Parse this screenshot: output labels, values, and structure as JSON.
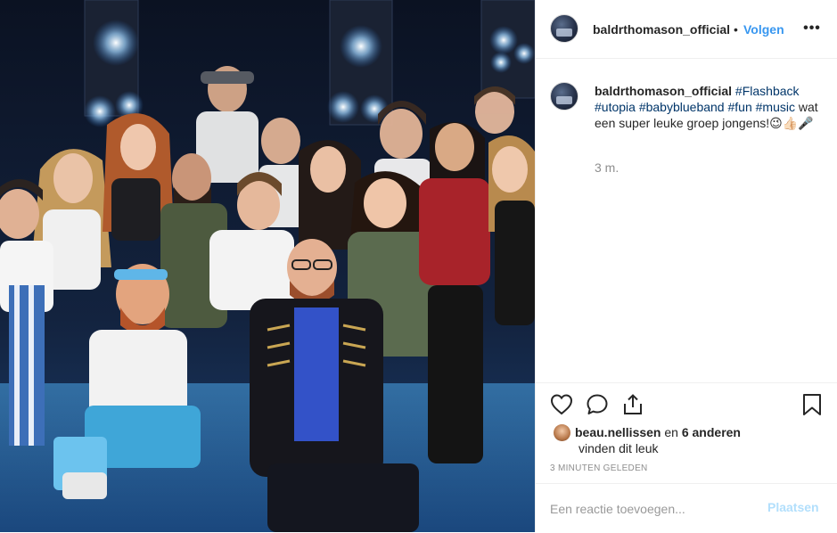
{
  "post": {
    "username": "baldrthomason_official",
    "follow_label": "Volgen",
    "dot": "•",
    "more_icon": "more-options-icon",
    "more_glyph": "•••"
  },
  "caption": {
    "username": "baldrthomason_official",
    "hashtags": [
      "#Flashback",
      "#utopia",
      "#babyblueband",
      "#fun",
      "#music"
    ],
    "text": "wat een super leuke groep jongens!😉👍🏻🎤",
    "time": "3 m."
  },
  "likes": {
    "user": "beau.nellissen",
    "connector": "en",
    "others": "6 anderen",
    "suffix": "vinden dit leuk"
  },
  "timestamp": "3 MINUTEN GELEDEN",
  "comment": {
    "placeholder": "Een reactie toevoegen...",
    "post_label": "Plaatsen"
  },
  "colors": {
    "link_blue": "#3897f0",
    "hashtag": "#003569",
    "muted": "#8e8e8e",
    "post_disabled": "#b2dffc"
  }
}
